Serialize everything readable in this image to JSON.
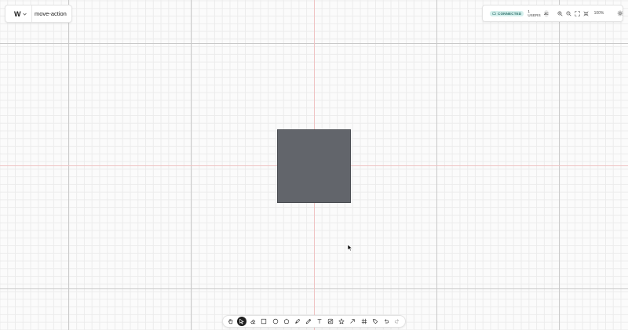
{
  "app": {
    "logo": "W",
    "document_title": "move-action"
  },
  "status": {
    "connection_label": "CONNECTED",
    "users_label": "1 USERS",
    "avatar_initials": "JC",
    "zoom_level": "100%"
  },
  "canvas": {
    "shape_fill": "#62656b",
    "axis_color": "#efc3c3"
  },
  "toolbar": {
    "tools": [
      {
        "name": "hand-tool",
        "icon": "hand-icon",
        "active": false
      },
      {
        "name": "select-tool",
        "icon": "cursor-icon",
        "active": true
      },
      {
        "name": "eraser-tool",
        "icon": "eraser-icon",
        "active": false
      },
      {
        "name": "rectangle-tool",
        "icon": "rectangle-icon",
        "active": false
      },
      {
        "name": "ellipse-tool",
        "icon": "circle-icon",
        "active": false
      },
      {
        "name": "polygon-tool",
        "icon": "polygon-icon",
        "active": false
      },
      {
        "name": "pen-tool",
        "icon": "pen-icon",
        "active": false
      },
      {
        "name": "pencil-tool",
        "icon": "pencil-icon",
        "active": false
      },
      {
        "name": "text-tool",
        "icon": "text-icon",
        "active": false
      },
      {
        "name": "image-tool",
        "icon": "image-icon",
        "active": false
      },
      {
        "name": "star-tool",
        "icon": "star-icon",
        "active": false
      },
      {
        "name": "arrow-tool",
        "icon": "arrow-icon",
        "active": false
      },
      {
        "name": "frame-tool",
        "icon": "frame-icon",
        "active": false
      },
      {
        "name": "tag-tool",
        "icon": "tag-icon",
        "active": false
      },
      {
        "name": "undo",
        "icon": "undo-icon",
        "active": false
      },
      {
        "name": "redo",
        "icon": "redo-icon",
        "active": false
      }
    ]
  }
}
